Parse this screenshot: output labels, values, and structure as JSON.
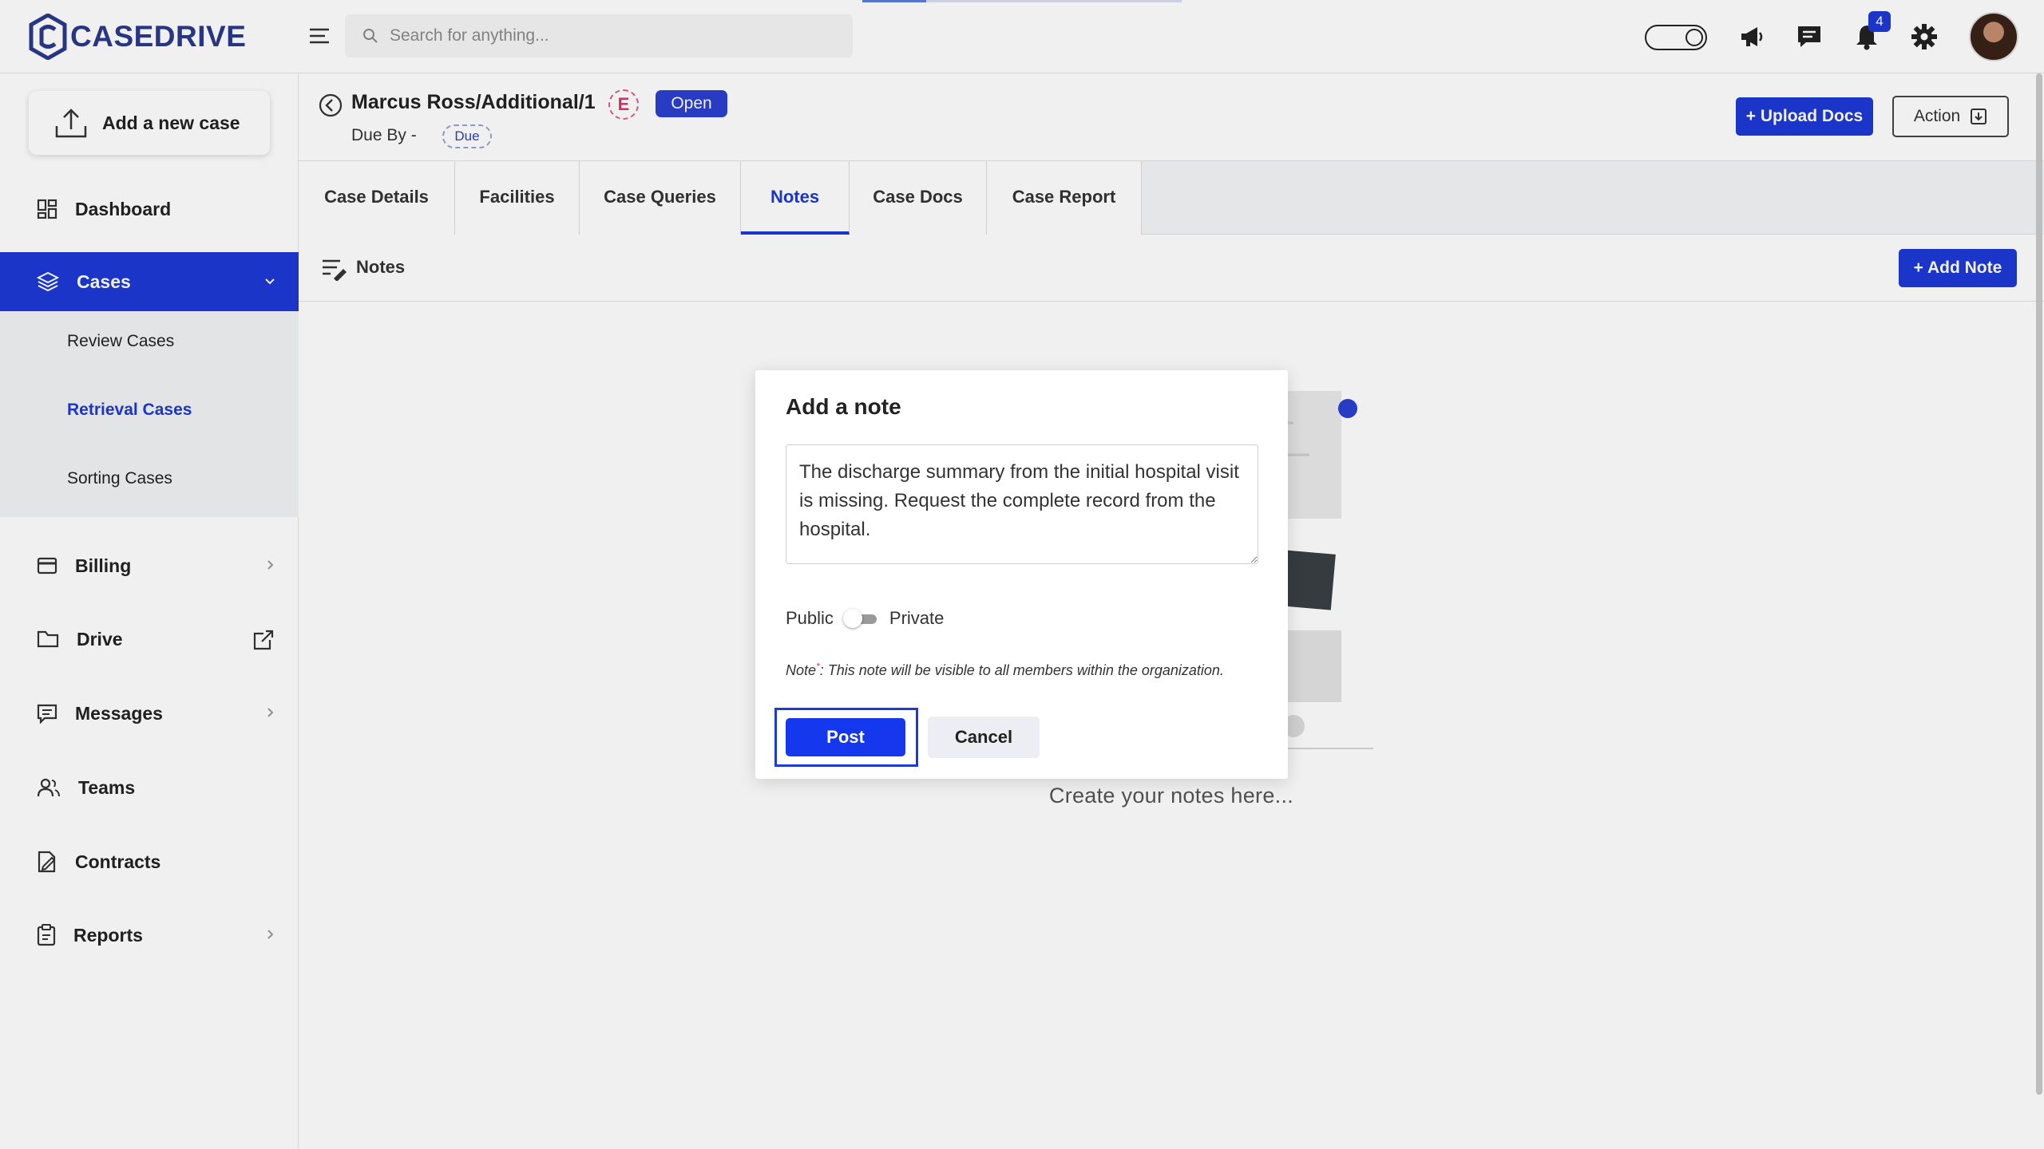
{
  "app": {
    "name": "CASEDRIVE",
    "search_placeholder": "Search for anything...",
    "notification_count": "4",
    "accent_color": "#1d39d6"
  },
  "top_icons": [
    "theme-toggle-icon",
    "megaphone-icon",
    "chat-icon",
    "bell-icon",
    "gear-icon"
  ],
  "sidebar": {
    "new_case_label": "Add a new case",
    "items": [
      {
        "label": "Dashboard",
        "icon": "dashboard-icon"
      },
      {
        "label": "Cases",
        "icon": "layers-icon",
        "active": true
      },
      {
        "label": "Billing",
        "icon": "card-icon"
      },
      {
        "label": "Drive",
        "icon": "folder-icon"
      },
      {
        "label": "Messages",
        "icon": "message-icon"
      },
      {
        "label": "Teams",
        "icon": "team-icon"
      },
      {
        "label": "Contracts",
        "icon": "contract-icon"
      },
      {
        "label": "Reports",
        "icon": "report-icon"
      }
    ],
    "cases_sub": [
      {
        "label": "Review Cases"
      },
      {
        "label": "Retrieval Cases",
        "active": true
      },
      {
        "label": "Sorting Cases"
      }
    ]
  },
  "case": {
    "title": "Marcus Ross/Additional/1",
    "e_badge": "E",
    "status": "Open",
    "due_by_label": "Due By -",
    "due_badge": "Due",
    "upload_label": "+ Upload Docs",
    "action_label": "Action"
  },
  "tabs": [
    "Case Details",
    "Facilities",
    "Case Queries",
    "Notes",
    "Case Docs",
    "Case Report"
  ],
  "active_tab": "Notes",
  "notes": {
    "toolbar_label": "Notes",
    "add_note_label": "+ Add Note",
    "empty_text": "Create your notes here..."
  },
  "modal": {
    "title": "Add a note",
    "textarea_value": "The discharge summary from the initial hospital visit is missing. Request the complete record from the hospital.",
    "public_label": "Public",
    "private_label": "Private",
    "note_prefix": "Note",
    "note_asterisk": "*",
    "note_text": ": This note will be visible to all members within the organization.",
    "post_label": "Post",
    "cancel_label": "Cancel"
  }
}
